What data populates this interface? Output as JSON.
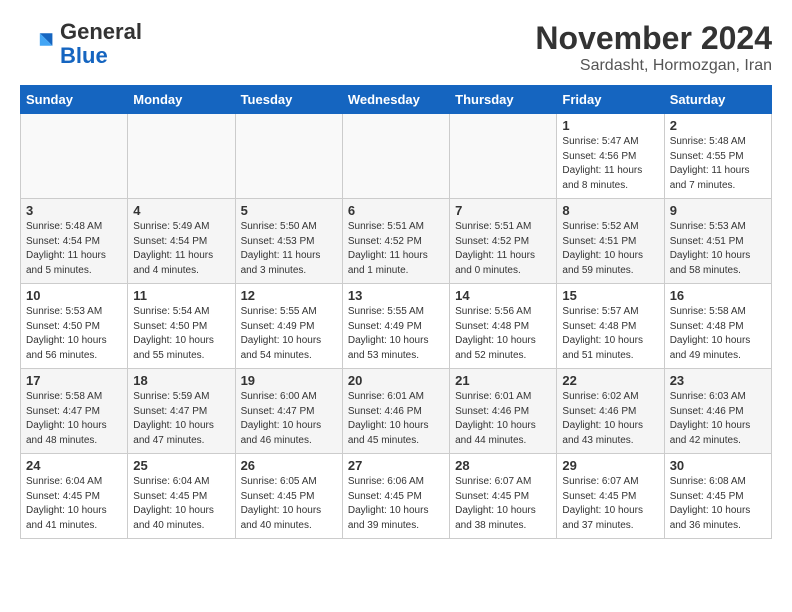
{
  "header": {
    "logo_line1": "General",
    "logo_line2": "Blue",
    "month": "November 2024",
    "location": "Sardasht, Hormozgan, Iran"
  },
  "days_of_week": [
    "Sunday",
    "Monday",
    "Tuesday",
    "Wednesday",
    "Thursday",
    "Friday",
    "Saturday"
  ],
  "weeks": [
    [
      {
        "day": "",
        "empty": true
      },
      {
        "day": "",
        "empty": true
      },
      {
        "day": "",
        "empty": true
      },
      {
        "day": "",
        "empty": true
      },
      {
        "day": "",
        "empty": true
      },
      {
        "day": "1",
        "sunrise": "5:47 AM",
        "sunset": "4:56 PM",
        "daylight": "11 hours and 8 minutes."
      },
      {
        "day": "2",
        "sunrise": "5:48 AM",
        "sunset": "4:55 PM",
        "daylight": "11 hours and 7 minutes."
      }
    ],
    [
      {
        "day": "3",
        "sunrise": "5:48 AM",
        "sunset": "4:54 PM",
        "daylight": "11 hours and 5 minutes."
      },
      {
        "day": "4",
        "sunrise": "5:49 AM",
        "sunset": "4:54 PM",
        "daylight": "11 hours and 4 minutes."
      },
      {
        "day": "5",
        "sunrise": "5:50 AM",
        "sunset": "4:53 PM",
        "daylight": "11 hours and 3 minutes."
      },
      {
        "day": "6",
        "sunrise": "5:51 AM",
        "sunset": "4:52 PM",
        "daylight": "11 hours and 1 minute."
      },
      {
        "day": "7",
        "sunrise": "5:51 AM",
        "sunset": "4:52 PM",
        "daylight": "11 hours and 0 minutes."
      },
      {
        "day": "8",
        "sunrise": "5:52 AM",
        "sunset": "4:51 PM",
        "daylight": "10 hours and 59 minutes."
      },
      {
        "day": "9",
        "sunrise": "5:53 AM",
        "sunset": "4:51 PM",
        "daylight": "10 hours and 58 minutes."
      }
    ],
    [
      {
        "day": "10",
        "sunrise": "5:53 AM",
        "sunset": "4:50 PM",
        "daylight": "10 hours and 56 minutes."
      },
      {
        "day": "11",
        "sunrise": "5:54 AM",
        "sunset": "4:50 PM",
        "daylight": "10 hours and 55 minutes."
      },
      {
        "day": "12",
        "sunrise": "5:55 AM",
        "sunset": "4:49 PM",
        "daylight": "10 hours and 54 minutes."
      },
      {
        "day": "13",
        "sunrise": "5:55 AM",
        "sunset": "4:49 PM",
        "daylight": "10 hours and 53 minutes."
      },
      {
        "day": "14",
        "sunrise": "5:56 AM",
        "sunset": "4:48 PM",
        "daylight": "10 hours and 52 minutes."
      },
      {
        "day": "15",
        "sunrise": "5:57 AM",
        "sunset": "4:48 PM",
        "daylight": "10 hours and 51 minutes."
      },
      {
        "day": "16",
        "sunrise": "5:58 AM",
        "sunset": "4:48 PM",
        "daylight": "10 hours and 49 minutes."
      }
    ],
    [
      {
        "day": "17",
        "sunrise": "5:58 AM",
        "sunset": "4:47 PM",
        "daylight": "10 hours and 48 minutes."
      },
      {
        "day": "18",
        "sunrise": "5:59 AM",
        "sunset": "4:47 PM",
        "daylight": "10 hours and 47 minutes."
      },
      {
        "day": "19",
        "sunrise": "6:00 AM",
        "sunset": "4:47 PM",
        "daylight": "10 hours and 46 minutes."
      },
      {
        "day": "20",
        "sunrise": "6:01 AM",
        "sunset": "4:46 PM",
        "daylight": "10 hours and 45 minutes."
      },
      {
        "day": "21",
        "sunrise": "6:01 AM",
        "sunset": "4:46 PM",
        "daylight": "10 hours and 44 minutes."
      },
      {
        "day": "22",
        "sunrise": "6:02 AM",
        "sunset": "4:46 PM",
        "daylight": "10 hours and 43 minutes."
      },
      {
        "day": "23",
        "sunrise": "6:03 AM",
        "sunset": "4:46 PM",
        "daylight": "10 hours and 42 minutes."
      }
    ],
    [
      {
        "day": "24",
        "sunrise": "6:04 AM",
        "sunset": "4:45 PM",
        "daylight": "10 hours and 41 minutes."
      },
      {
        "day": "25",
        "sunrise": "6:04 AM",
        "sunset": "4:45 PM",
        "daylight": "10 hours and 40 minutes."
      },
      {
        "day": "26",
        "sunrise": "6:05 AM",
        "sunset": "4:45 PM",
        "daylight": "10 hours and 40 minutes."
      },
      {
        "day": "27",
        "sunrise": "6:06 AM",
        "sunset": "4:45 PM",
        "daylight": "10 hours and 39 minutes."
      },
      {
        "day": "28",
        "sunrise": "6:07 AM",
        "sunset": "4:45 PM",
        "daylight": "10 hours and 38 minutes."
      },
      {
        "day": "29",
        "sunrise": "6:07 AM",
        "sunset": "4:45 PM",
        "daylight": "10 hours and 37 minutes."
      },
      {
        "day": "30",
        "sunrise": "6:08 AM",
        "sunset": "4:45 PM",
        "daylight": "10 hours and 36 minutes."
      }
    ]
  ],
  "labels": {
    "sunrise": "Sunrise:",
    "sunset": "Sunset:",
    "daylight": "Daylight:"
  }
}
